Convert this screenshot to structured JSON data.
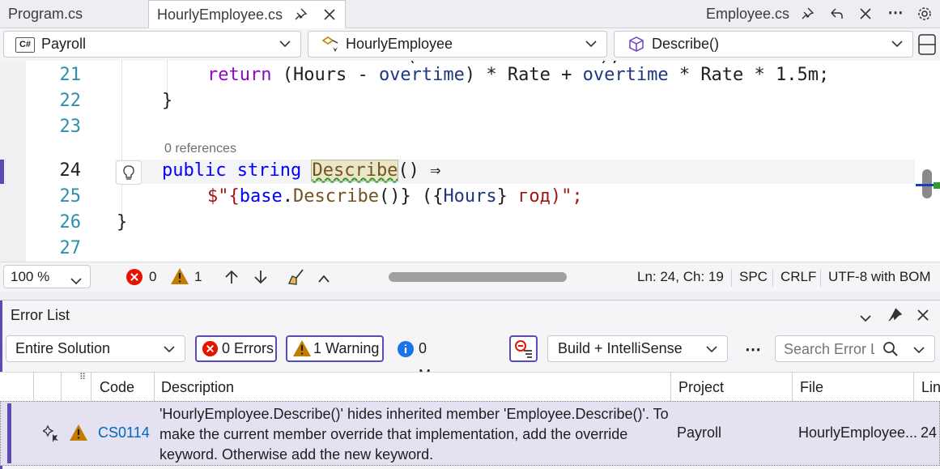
{
  "tabs": {
    "program": "Program.cs",
    "hourly": "HourlyEmployee.cs",
    "employee": "Employee.cs"
  },
  "nav": {
    "project": "Payroll",
    "project_badge": "C#",
    "type": "HourlyEmployee",
    "member": "Describe()"
  },
  "editor": {
    "lines": [
      "21",
      "22",
      "23",
      "24",
      "25",
      "26",
      "27"
    ],
    "references": "0 references",
    "code": {
      "l21_return": "return",
      "l21_rest_a": " (Hours - ",
      "l21_overtime1": "overtime",
      "l21_rest_b": ") * Rate + ",
      "l21_overtime2": "overtime",
      "l21_rest_c": " * Rate * 1.5m;",
      "l22": "}",
      "l24_public": "public",
      "l24_string": "string",
      "l24_describe": "Describe",
      "l24_rest": "() ⇒",
      "l25_a": "$\"{",
      "l25_base": "base",
      "l25_dot": ".",
      "l25_describe": "Describe",
      "l25_b": "()} (",
      "l25_hours_open": "{",
      "l25_hours": "Hours",
      "l25_hours_close": "}",
      "l25_c": " год)\";",
      "l26": "}"
    }
  },
  "status": {
    "zoom": "100 %",
    "errors": "0",
    "warnings": "1",
    "position": "Ln: 24, Ch: 19",
    "whitespace": "SPC",
    "line_ending": "CRLF",
    "encoding": "UTF-8 with BOM"
  },
  "error_list": {
    "title": "Error List",
    "scope": "Entire Solution",
    "errors_btn": "0 Errors",
    "warnings_btn": "1 Warning",
    "messages_btn": "0 Messages",
    "source": "Build + IntelliSense",
    "more": "⋯",
    "search_placeholder": "Search Error L",
    "columns": {
      "code": "Code",
      "description": "Description",
      "project": "Project",
      "file": "File",
      "line": "Lin"
    },
    "rows": [
      {
        "code": "CS0114",
        "description_1": "'HourlyEmployee.Describe()' hides inherited member 'Employee.Describe()'. To",
        "description_2": "make the current member override that implementation, add the override",
        "description_3": "keyword. Otherwise add the new keyword.",
        "project": "Payroll",
        "file": "HourlyEmployee...",
        "line": "24"
      }
    ]
  },
  "colors": {
    "accent": "#5b4bb7",
    "error": "#e51400",
    "warning": "#c27d00",
    "info": "#1a73e8",
    "link": "#0066bf"
  }
}
